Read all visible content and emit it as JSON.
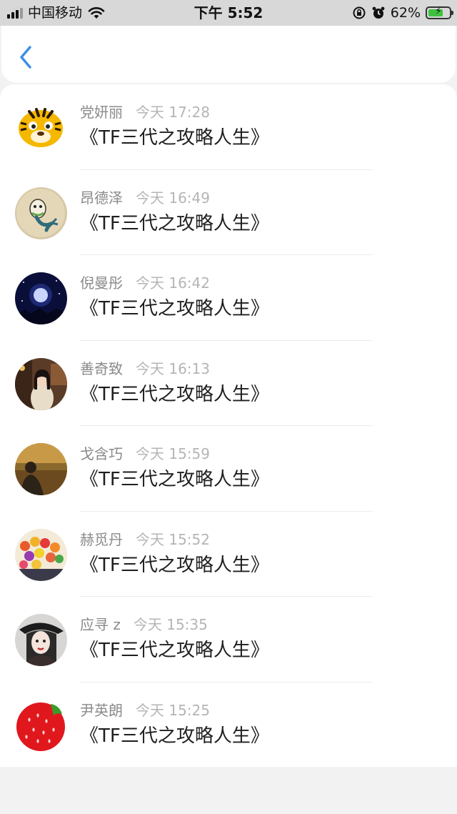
{
  "status_bar": {
    "carrier": "中国移动",
    "time": "下午 5:52",
    "battery": "62%",
    "icons": [
      "signal-icon",
      "wifi-icon",
      "rotation-lock-icon",
      "alarm-icon",
      "battery-charging-icon"
    ],
    "battery_level": 0.62
  },
  "header": {
    "back_icon": "chevron-left-icon",
    "accent_color": "#3a8ee6"
  },
  "comments": [
    {
      "name": "党妍丽",
      "time": "今天 17:28",
      "title": "《TF三代之攻略人生》",
      "avatar": "tiger-avatar"
    },
    {
      "name": "昂德泽",
      "time": "今天 16:49",
      "title": "《TF三代之攻略人生》",
      "avatar": "sketch-avatar"
    },
    {
      "name": "倪曼彤",
      "time": "今天 16:42",
      "title": "《TF三代之攻略人生》",
      "avatar": "moon-night-avatar"
    },
    {
      "name": "善奇致",
      "time": "今天 16:13",
      "title": "《TF三代之攻略人生》",
      "avatar": "cafe-girl-avatar"
    },
    {
      "name": "戈含巧",
      "time": "今天 15:59",
      "title": "《TF三代之攻略人生》",
      "avatar": "sunset-person-avatar"
    },
    {
      "name": "赫觅丹",
      "time": "今天 15:52",
      "title": "《TF三代之攻略人生》",
      "avatar": "flowers-avatar"
    },
    {
      "name": "应寻 z",
      "time": "今天 15:35",
      "title": "《TF三代之攻略人生》",
      "avatar": "hat-girl-avatar"
    },
    {
      "name": "尹英朗",
      "time": "今天 15:25",
      "title": "《TF三代之攻略人生》",
      "avatar": "strawberry-avatar"
    }
  ]
}
